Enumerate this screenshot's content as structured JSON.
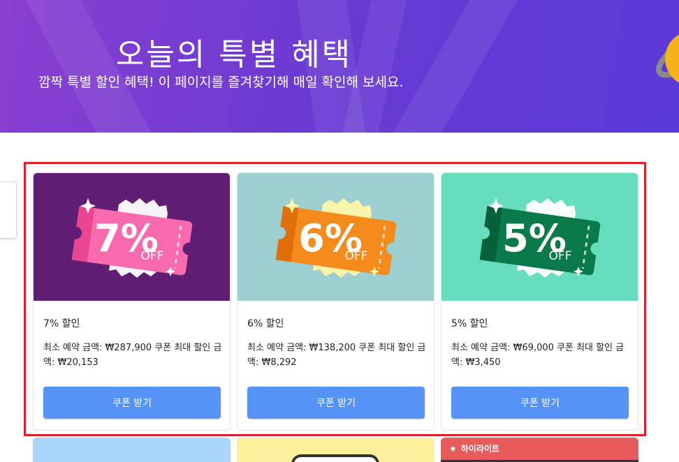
{
  "hero": {
    "title": "오늘의 특별 혜택",
    "subtitle": "깜짝 특별 할인 혜택! 이 페이지를 즐겨찾기해 매일 확인해 보세요."
  },
  "cards": [
    {
      "discount": "7%",
      "off": "OFF",
      "title": "7% 할인",
      "desc": "최소 예약 금액: ₩287,900 쿠폰 최대 할인 금액: ₩20,153",
      "button": "쿠폰 받기",
      "bg": "#5f1d73",
      "ticket": "#f969ae",
      "ticket_dark": "#e94590",
      "glow": "#ffffff",
      "sparkle": "#ffffff"
    },
    {
      "discount": "6%",
      "off": "OFF",
      "title": "6% 할인",
      "desc": "최소 예약 금액: ₩138,200 쿠폰 최대 할인 금액: ₩8,292",
      "button": "쿠폰 받기",
      "bg": "#9dcfd0",
      "ticket": "#f48b1a",
      "ticket_dark": "#e06f0b",
      "glow": "#fff4a8",
      "sparkle": "#fff4a8"
    },
    {
      "discount": "5%",
      "off": "OFF",
      "title": "5% 할인",
      "desc": "최소 예약 금액: ₩69,000 쿠폰 최대 할인 금액: ₩3,450",
      "button": "쿠폰 받기",
      "bg": "#66ddbc",
      "ticket": "#0a7a4b",
      "ticket_dark": "#06603a",
      "glow": "#ffffff",
      "sparkle": "#ffffff"
    }
  ],
  "highlight_label": "하이라이트"
}
